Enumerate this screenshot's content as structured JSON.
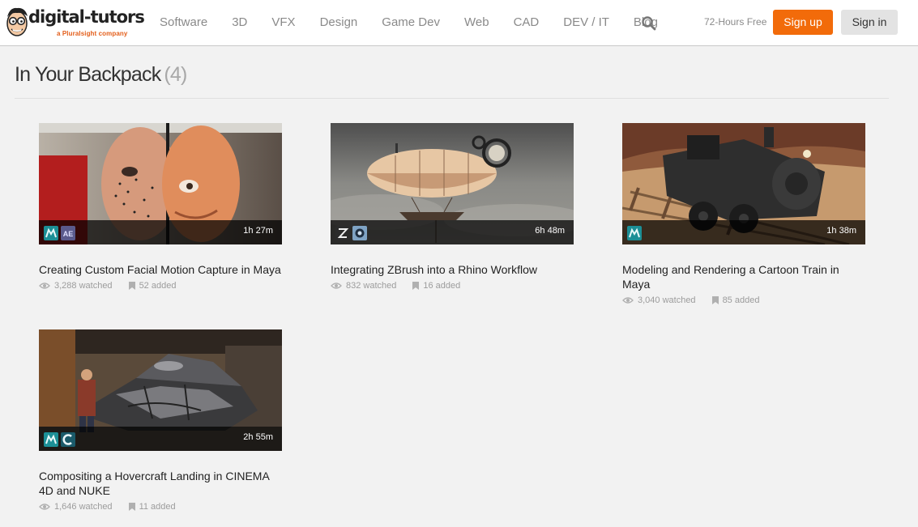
{
  "header": {
    "logo_text": "digital-tutors",
    "logo_subtitle": "a Pluralsight company",
    "nav": [
      "Software",
      "3D",
      "VFX",
      "Design",
      "Game Dev",
      "Web",
      "CAD",
      "DEV / IT",
      "Blog"
    ],
    "trial_text": "72-Hours Free",
    "signup_label": "Sign up",
    "signin_label": "Sign in"
  },
  "page": {
    "title": "In Your Backpack",
    "count": "(4)"
  },
  "courses": [
    {
      "title": "Creating Custom Facial Motion Capture in Maya",
      "duration": "1h 27m",
      "watched": "3,288 watched",
      "added": "52 added",
      "software_icons": [
        "maya-icon",
        "after-effects-icon"
      ]
    },
    {
      "title": "Integrating ZBrush into a Rhino Workflow",
      "duration": "6h 48m",
      "watched": "832 watched",
      "added": "16 added",
      "software_icons": [
        "zbrush-icon",
        "rhino-icon"
      ]
    },
    {
      "title": "Modeling and Rendering a Cartoon Train in Maya",
      "duration": "1h 38m",
      "watched": "3,040 watched",
      "added": "85 added",
      "software_icons": [
        "maya-icon"
      ]
    },
    {
      "title": "Compositing a Hovercraft Landing in CINEMA 4D and NUKE",
      "duration": "2h 55m",
      "watched": "1,646 watched",
      "added": "11 added",
      "software_icons": [
        "maya-icon",
        "cinema4d-icon"
      ]
    }
  ],
  "colors": {
    "accent": "#f26b0a",
    "background": "#f2f2f2",
    "logo_orange": "#e35e1a"
  }
}
